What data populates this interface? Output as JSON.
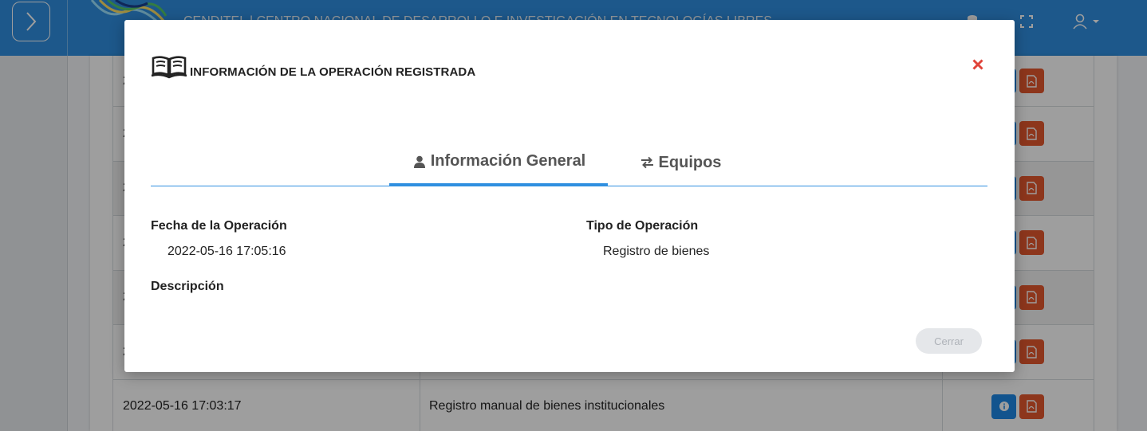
{
  "app": {
    "site_title": "CENDITEL | CENTRO NACIONAL DE DESARROLLO E INVESTIGACIÓN EN TECNOLOGÍAS LIBRES"
  },
  "table": {
    "rows": [
      {
        "date": "2",
        "description": ""
      },
      {
        "date": "2",
        "description": ""
      },
      {
        "date": "2",
        "description": ""
      },
      {
        "date": "2",
        "description": ""
      },
      {
        "date": "2",
        "description": ""
      },
      {
        "date": "2",
        "description": ""
      },
      {
        "date": "2022-05-16 17:03:17",
        "description": "Registro manual de bienes institucionales"
      }
    ]
  },
  "modal": {
    "title": "INFORMACIÓN DE LA OPERACIÓN REGISTRADA",
    "close_symbol": "×",
    "tabs": [
      {
        "label": "Información General",
        "icon": "user-icon",
        "active": true
      },
      {
        "label": "Equipos",
        "icon": "exchange-icon",
        "active": false
      }
    ],
    "fields": {
      "fecha_label": "Fecha de la Operación",
      "fecha_value": "2022-05-16 17:05:16",
      "tipo_label": "Tipo de Operación",
      "tipo_value": "Registro de bienes",
      "descripcion_label": "Descripción",
      "descripcion_value": ""
    },
    "close_button_label": "Cerrar"
  },
  "colors": {
    "accent": "#2f8fe0",
    "close_x": "#e0443a",
    "pdf_button": "#e4572e",
    "info_button": "#1e88e5"
  }
}
